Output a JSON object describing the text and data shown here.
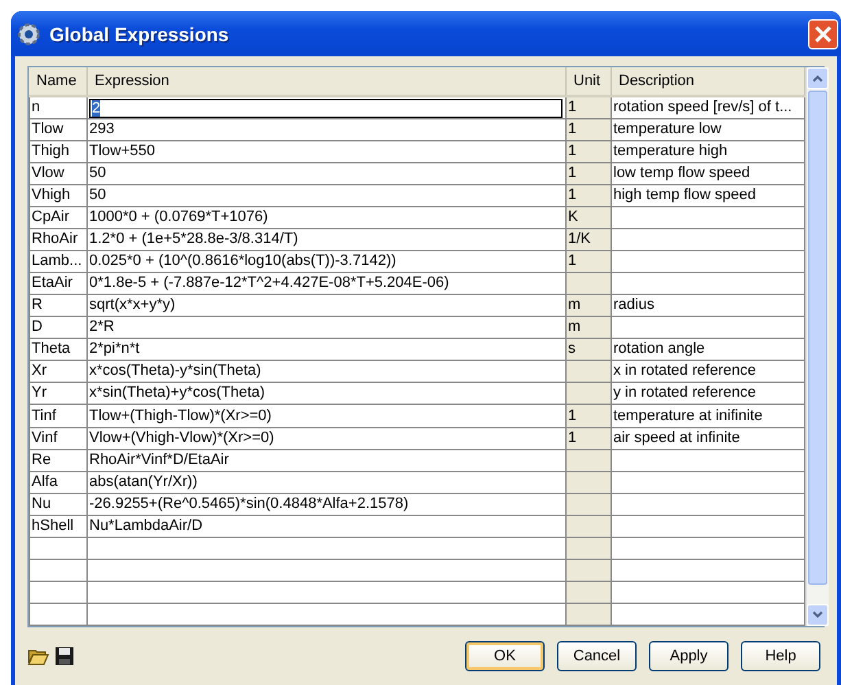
{
  "window": {
    "title": "Global Expressions"
  },
  "table": {
    "columns": [
      "Name",
      "Expression",
      "Unit",
      "Description"
    ],
    "rows": [
      {
        "name": "n",
        "expression": "2",
        "unit": "1",
        "description": "rotation speed [rev/s] of t...",
        "editing": true
      },
      {
        "name": "Tlow",
        "expression": "293",
        "unit": "1",
        "description": "temperature low",
        "editing": false
      },
      {
        "name": "Thigh",
        "expression": "Tlow+550",
        "unit": "1",
        "description": "temperature high",
        "editing": false
      },
      {
        "name": "Vlow",
        "expression": "50",
        "unit": "1",
        "description": "low temp flow speed",
        "editing": false
      },
      {
        "name": "Vhigh",
        "expression": "50",
        "unit": "1",
        "description": "high temp flow speed",
        "editing": false
      },
      {
        "name": "CpAir",
        "expression": "1000*0 + (0.0769*T+1076)",
        "unit": "K",
        "description": "",
        "editing": false
      },
      {
        "name": "RhoAir",
        "expression": "1.2*0 + (1e+5*28.8e-3/8.314/T)",
        "unit": "1/K",
        "description": "",
        "editing": false
      },
      {
        "name": "Lamb...",
        "expression": "0.025*0 + (10^(0.8616*log10(abs(T))-3.7142))",
        "unit": "1",
        "description": "",
        "editing": false
      },
      {
        "name": "EtaAir",
        "expression": "0*1.8e-5 + (-7.887e-12*T^2+4.427E-08*T+5.204E-06)",
        "unit": "",
        "description": "",
        "editing": false
      },
      {
        "name": "R",
        "expression": "sqrt(x*x+y*y)",
        "unit": "m",
        "description": "radius",
        "editing": false
      },
      {
        "name": "D",
        "expression": "2*R",
        "unit": "m",
        "description": "",
        "editing": false
      },
      {
        "name": "Theta",
        "expression": "2*pi*n*t",
        "unit": "s",
        "description": "rotation angle",
        "editing": false
      },
      {
        "name": "Xr",
        "expression": "x*cos(Theta)-y*sin(Theta)",
        "unit": "",
        "description": "x in rotated reference",
        "editing": false
      },
      {
        "name": "Yr",
        "expression": "x*sin(Theta)+y*cos(Theta)",
        "unit": "",
        "description": "y in rotated reference",
        "editing": false
      },
      {
        "name": "Tinf",
        "expression": "Tlow+(Thigh-Tlow)*(Xr>=0)",
        "unit": "1",
        "description": "temperature at inifinite",
        "editing": false
      },
      {
        "name": "Vinf",
        "expression": "Vlow+(Vhigh-Vlow)*(Xr>=0)",
        "unit": "1",
        "description": "air speed at infinite",
        "editing": false
      },
      {
        "name": "Re",
        "expression": "RhoAir*Vinf*D/EtaAir",
        "unit": "",
        "description": "",
        "editing": false
      },
      {
        "name": "Alfa",
        "expression": "abs(atan(Yr/Xr))",
        "unit": "",
        "description": "",
        "editing": false
      },
      {
        "name": "Nu",
        "expression": "-26.9255+(Re^0.5465)*sin(0.4848*Alfa+2.1578)",
        "unit": "",
        "description": "",
        "editing": false
      },
      {
        "name": "hShell",
        "expression": "Nu*LambdaAir/D",
        "unit": "",
        "description": "",
        "editing": false
      }
    ]
  },
  "buttons": [
    {
      "label": "OK",
      "default": true
    },
    {
      "label": "Cancel",
      "default": false
    },
    {
      "label": "Apply",
      "default": false
    },
    {
      "label": "Help",
      "default": false
    }
  ]
}
